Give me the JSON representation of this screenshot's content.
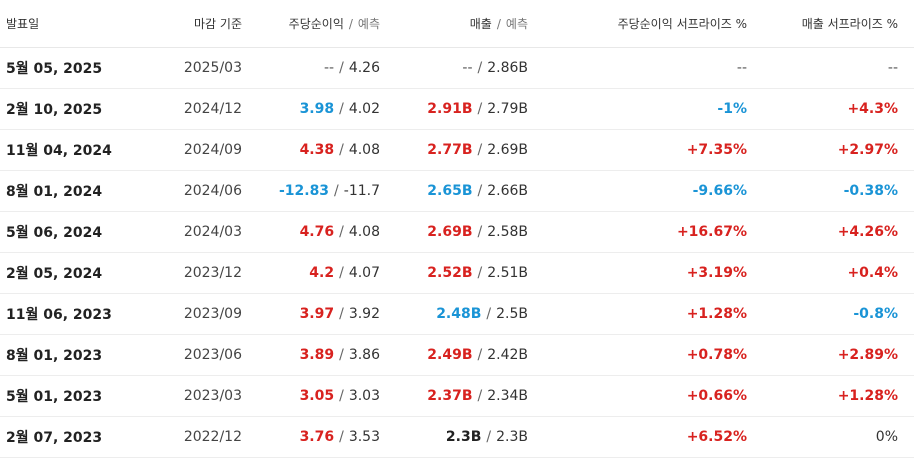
{
  "headers": {
    "release_date": "발표일",
    "period_end": "마감 기준",
    "eps": "주당순이익",
    "eps_sep": "/",
    "eps_estimate": "예측",
    "revenue": "매출",
    "revenue_sep": "/",
    "revenue_estimate": "예측",
    "eps_surprise": "주당순이익 서프라이즈 %",
    "revenue_surprise": "매출 서프라이즈 %"
  },
  "colors": {
    "beat": "#d8221f",
    "miss": "#1a94d6"
  },
  "rows": [
    {
      "date": "5월 05, 2025",
      "period": "2025/03",
      "eps": "--",
      "eps_status": "na",
      "eps_est": "4.26",
      "rev": "--",
      "rev_status": "na",
      "rev_est": "2.86B",
      "eps_surprise": "--",
      "eps_surprise_status": "na",
      "rev_surprise": "--",
      "rev_surprise_status": "na"
    },
    {
      "date": "2월 10, 2025",
      "period": "2024/12",
      "eps": "3.98",
      "eps_status": "neg",
      "eps_est": "4.02",
      "rev": "2.91B",
      "rev_status": "pos",
      "rev_est": "2.79B",
      "eps_surprise": "-1%",
      "eps_surprise_status": "neg",
      "rev_surprise": "+4.3%",
      "rev_surprise_status": "pos"
    },
    {
      "date": "11월 04, 2024",
      "period": "2024/09",
      "eps": "4.38",
      "eps_status": "pos",
      "eps_est": "4.08",
      "rev": "2.77B",
      "rev_status": "pos",
      "rev_est": "2.69B",
      "eps_surprise": "+7.35%",
      "eps_surprise_status": "pos",
      "rev_surprise": "+2.97%",
      "rev_surprise_status": "pos"
    },
    {
      "date": "8월 01, 2024",
      "period": "2024/06",
      "eps": "-12.83",
      "eps_status": "neg",
      "eps_est": "-11.7",
      "rev": "2.65B",
      "rev_status": "neg",
      "rev_est": "2.66B",
      "eps_surprise": "-9.66%",
      "eps_surprise_status": "neg",
      "rev_surprise": "-0.38%",
      "rev_surprise_status": "neg"
    },
    {
      "date": "5월 06, 2024",
      "period": "2024/03",
      "eps": "4.76",
      "eps_status": "pos",
      "eps_est": "4.08",
      "rev": "2.69B",
      "rev_status": "pos",
      "rev_est": "2.58B",
      "eps_surprise": "+16.67%",
      "eps_surprise_status": "pos",
      "rev_surprise": "+4.26%",
      "rev_surprise_status": "pos"
    },
    {
      "date": "2월 05, 2024",
      "period": "2023/12",
      "eps": "4.2",
      "eps_status": "pos",
      "eps_est": "4.07",
      "rev": "2.52B",
      "rev_status": "pos",
      "rev_est": "2.51B",
      "eps_surprise": "+3.19%",
      "eps_surprise_status": "pos",
      "rev_surprise": "+0.4%",
      "rev_surprise_status": "pos"
    },
    {
      "date": "11월 06, 2023",
      "period": "2023/09",
      "eps": "3.97",
      "eps_status": "pos",
      "eps_est": "3.92",
      "rev": "2.48B",
      "rev_status": "neg",
      "rev_est": "2.5B",
      "eps_surprise": "+1.28%",
      "eps_surprise_status": "pos",
      "rev_surprise": "-0.8%",
      "rev_surprise_status": "neg"
    },
    {
      "date": "8월 01, 2023",
      "period": "2023/06",
      "eps": "3.89",
      "eps_status": "pos",
      "eps_est": "3.86",
      "rev": "2.49B",
      "rev_status": "pos",
      "rev_est": "2.42B",
      "eps_surprise": "+0.78%",
      "eps_surprise_status": "pos",
      "rev_surprise": "+2.89%",
      "rev_surprise_status": "pos"
    },
    {
      "date": "5월 01, 2023",
      "period": "2023/03",
      "eps": "3.05",
      "eps_status": "pos",
      "eps_est": "3.03",
      "rev": "2.37B",
      "rev_status": "pos",
      "rev_est": "2.34B",
      "eps_surprise": "+0.66%",
      "eps_surprise_status": "pos",
      "rev_surprise": "+1.28%",
      "rev_surprise_status": "pos"
    },
    {
      "date": "2월 07, 2023",
      "period": "2022/12",
      "eps": "3.76",
      "eps_status": "pos",
      "eps_est": "3.53",
      "rev": "2.3B",
      "rev_status": "strong",
      "rev_est": "2.3B",
      "eps_surprise": "+6.52%",
      "eps_surprise_status": "pos",
      "rev_surprise": "0%",
      "rev_surprise_status": "flat"
    }
  ]
}
